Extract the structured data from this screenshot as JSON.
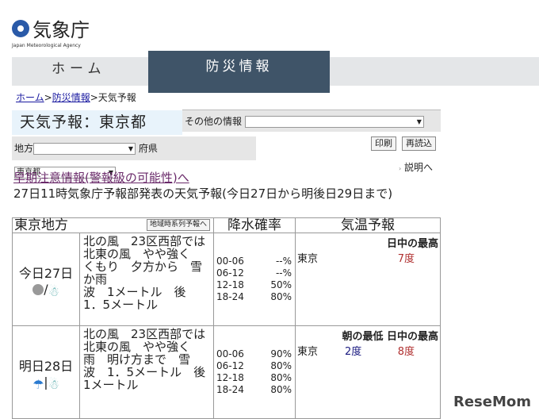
{
  "logo": {
    "name": "気象庁",
    "sub": "Japan Meteorological Agency"
  },
  "nav": {
    "home": "ホーム",
    "bousai": "防災情報"
  },
  "breadcrumb": {
    "home": "ホーム",
    "bousai": "防災情報",
    "current": "天気予報",
    "sep": ">"
  },
  "title": "天気予報：東京都",
  "other_info": {
    "label": "その他の情報",
    "value": ""
  },
  "region": {
    "label": "地方",
    "value": ""
  },
  "pref": {
    "label": "府県",
    "value": "東京都"
  },
  "buttons": {
    "print": "印刷",
    "reload": "再読込"
  },
  "explain": "説明へ",
  "early_warning_link": "早期注意情報(警報級の可能性)へ",
  "issued": "27日11時気象庁予報部発表の天気予報(今日27日から明後日29日まで)",
  "table": {
    "area": "東京地方",
    "timeseries_button": "地域時系列予報へ",
    "pop_header": "降水確率",
    "temp_header": "気温予報",
    "rows": [
      {
        "day": "今日27日",
        "icons": [
          "cloud",
          "snow"
        ],
        "weather": "北の風　23区西部では　北東の風　やや強く　くもり　夕方から　雪か雨",
        "wave": "波　1メートル　後　1．5メートル",
        "pop": [
          [
            "00-06",
            "--%"
          ],
          [
            "06-12",
            "--%"
          ],
          [
            "12-18",
            "50%"
          ],
          [
            "18-24",
            "80%"
          ]
        ],
        "temp_labels": {
          "min": "",
          "max": "日中の最高"
        },
        "city": "東京",
        "min": "",
        "max": "7度"
      },
      {
        "day": "明日28日",
        "icons": [
          "umbrella",
          "snow"
        ],
        "weather": "北の風　23区西部では　北東の風　やや強く　雨　明け方まで　雪",
        "wave": "波　1．5メートル　後　1メートル",
        "pop": [
          [
            "00-06",
            "90%"
          ],
          [
            "06-12",
            "80%"
          ],
          [
            "12-18",
            "80%"
          ],
          [
            "18-24",
            "80%"
          ]
        ],
        "temp_labels": {
          "min": "朝の最低",
          "max": "日中の最高"
        },
        "city": "東京",
        "min": "2度",
        "max": "8度"
      }
    ]
  },
  "watermark": "ReseMom",
  "colors": {
    "nav_active": "#3f5468",
    "min_temp": "#1a1a80",
    "max_temp": "#b03030"
  }
}
